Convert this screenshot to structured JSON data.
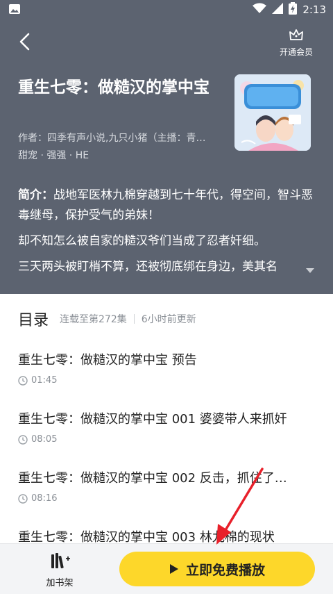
{
  "status_bar": {
    "time": "2:13"
  },
  "header": {
    "vip_label": "开通会员"
  },
  "book": {
    "title": "重生七零：做糙汉的掌中宝",
    "author": "作者：四季有声小说,九只小猪（主播：青…",
    "tags": "甜宠 · 强强 · HE",
    "intro_label": "简介：",
    "intro_line1": "战地军医林九棉穿越到七十年代，得空间，智斗恶毒继母，保护受气的弟妹！",
    "intro_line2": "却不知怎么被自家的糙汉爷们当成了忍者奸细。",
    "intro_line3": "三天两头被盯梢不算，还被彻底绑在身边，美其名"
  },
  "toc": {
    "title": "目录",
    "progress": "连载至第272集",
    "updated": "6小时前更新",
    "chapters": [
      {
        "title": "重生七零：做糙汉的掌中宝 预告",
        "duration": "01:45"
      },
      {
        "title": "重生七零：做糙汉的掌中宝 001 婆婆带人来抓奸",
        "duration": "08:05"
      },
      {
        "title": "重生七零：做糙汉的掌中宝 002 反击，抓住了…",
        "duration": "08:16"
      },
      {
        "title": "重生七零：做糙汉的掌中宝 003 林九棉的现状",
        "duration": ""
      }
    ]
  },
  "bottom": {
    "shelf_label": "加书架",
    "play_label": "立即免费播放"
  },
  "colors": {
    "header_bg": "#5c6370",
    "accent": "#fdd72a",
    "annotation": "#e8202a"
  }
}
